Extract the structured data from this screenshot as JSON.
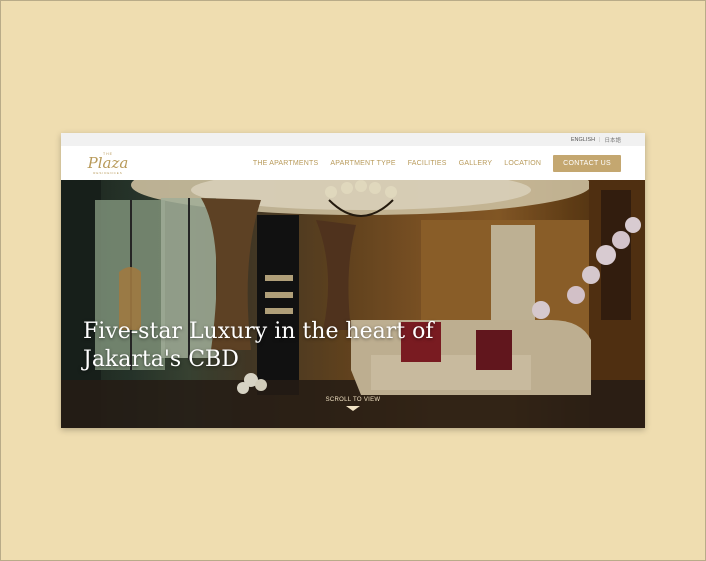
{
  "topbar": {
    "lang_en": "ENGLISH",
    "lang_jp": "日本語"
  },
  "logo": {
    "the": "THE",
    "name": "Plaza",
    "sub": "RESIDENCES"
  },
  "nav": {
    "items": [
      {
        "label": "THE APARTMENTS"
      },
      {
        "label": "APARTMENT TYPE"
      },
      {
        "label": "FACILITIES"
      },
      {
        "label": "GALLERY"
      },
      {
        "label": "LOCATION"
      }
    ],
    "contact_label": "CONTACT US"
  },
  "hero": {
    "title_line1": "Five-star Luxury in the heart of",
    "title_line2": "Jakarta's CBD",
    "scroll_label": "SCROLL TO VIEW"
  },
  "colors": {
    "page_bg": "#efddb0",
    "accent_gold": "#b89a5a",
    "button_gold": "#c4a770"
  }
}
